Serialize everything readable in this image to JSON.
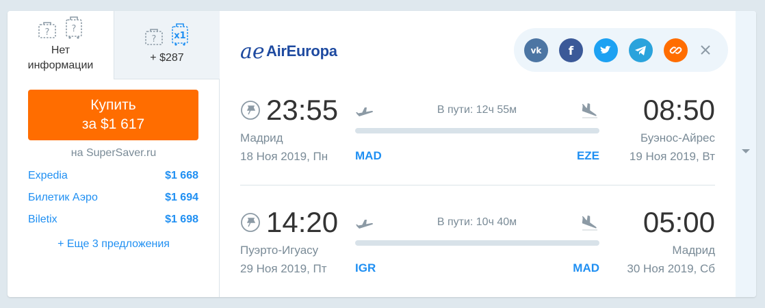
{
  "tabs": [
    {
      "label": "Нет информации",
      "line1": "Нет",
      "line2": "информации"
    },
    {
      "label": "+ $287",
      "bag_badge": "x1"
    }
  ],
  "buy": {
    "line1": "Купить",
    "line2": "за $1 617"
  },
  "agency": "на SuperSaver.ru",
  "offers": [
    {
      "name": "Expedia",
      "price": "$1 668"
    },
    {
      "name": "Билетик Аэро",
      "price": "$1 694"
    },
    {
      "name": "Biletix",
      "price": "$1 698"
    }
  ],
  "more_offers": "+ Еще 3 предложения",
  "airline": {
    "name": "AirEuropa",
    "logo_mark": "ae",
    "brand_color": "#1e4aa0"
  },
  "share": {
    "buttons": [
      {
        "icon": "vk-icon",
        "color": "#4c75a3",
        "glyph": "vk"
      },
      {
        "icon": "facebook-icon",
        "color": "#3b5998",
        "glyph": "f"
      },
      {
        "icon": "twitter-icon",
        "color": "#1da1f2"
      },
      {
        "icon": "telegram-icon",
        "color": "#2aa3dc"
      },
      {
        "icon": "link-icon",
        "color": "#ff6d00"
      }
    ],
    "close_icon": "close-icon"
  },
  "flights": [
    {
      "dep_time": "23:55",
      "arr_time": "08:50",
      "duration": "В пути: 12ч 55м",
      "dep_city": "Мадрид",
      "arr_city": "Буэнос-Айрес",
      "dep_date": "18 Ноя 2019, Пн",
      "arr_date": "19 Ноя 2019, Вт",
      "dep_iata": "MAD",
      "arr_iata": "EZE"
    },
    {
      "dep_time": "14:20",
      "arr_time": "05:00",
      "duration": "В пути: 10ч 40м",
      "dep_city": "Пуэрто-Игуасу",
      "arr_city": "Мадрид",
      "dep_date": "29 Ноя 2019, Пт",
      "arr_date": "30 Ноя 2019, Сб",
      "dep_iata": "IGR",
      "arr_iata": "MAD"
    }
  ],
  "colors": {
    "accent": "#ff6d00",
    "link": "#1f8ff2",
    "muted": "#7a8b97"
  }
}
